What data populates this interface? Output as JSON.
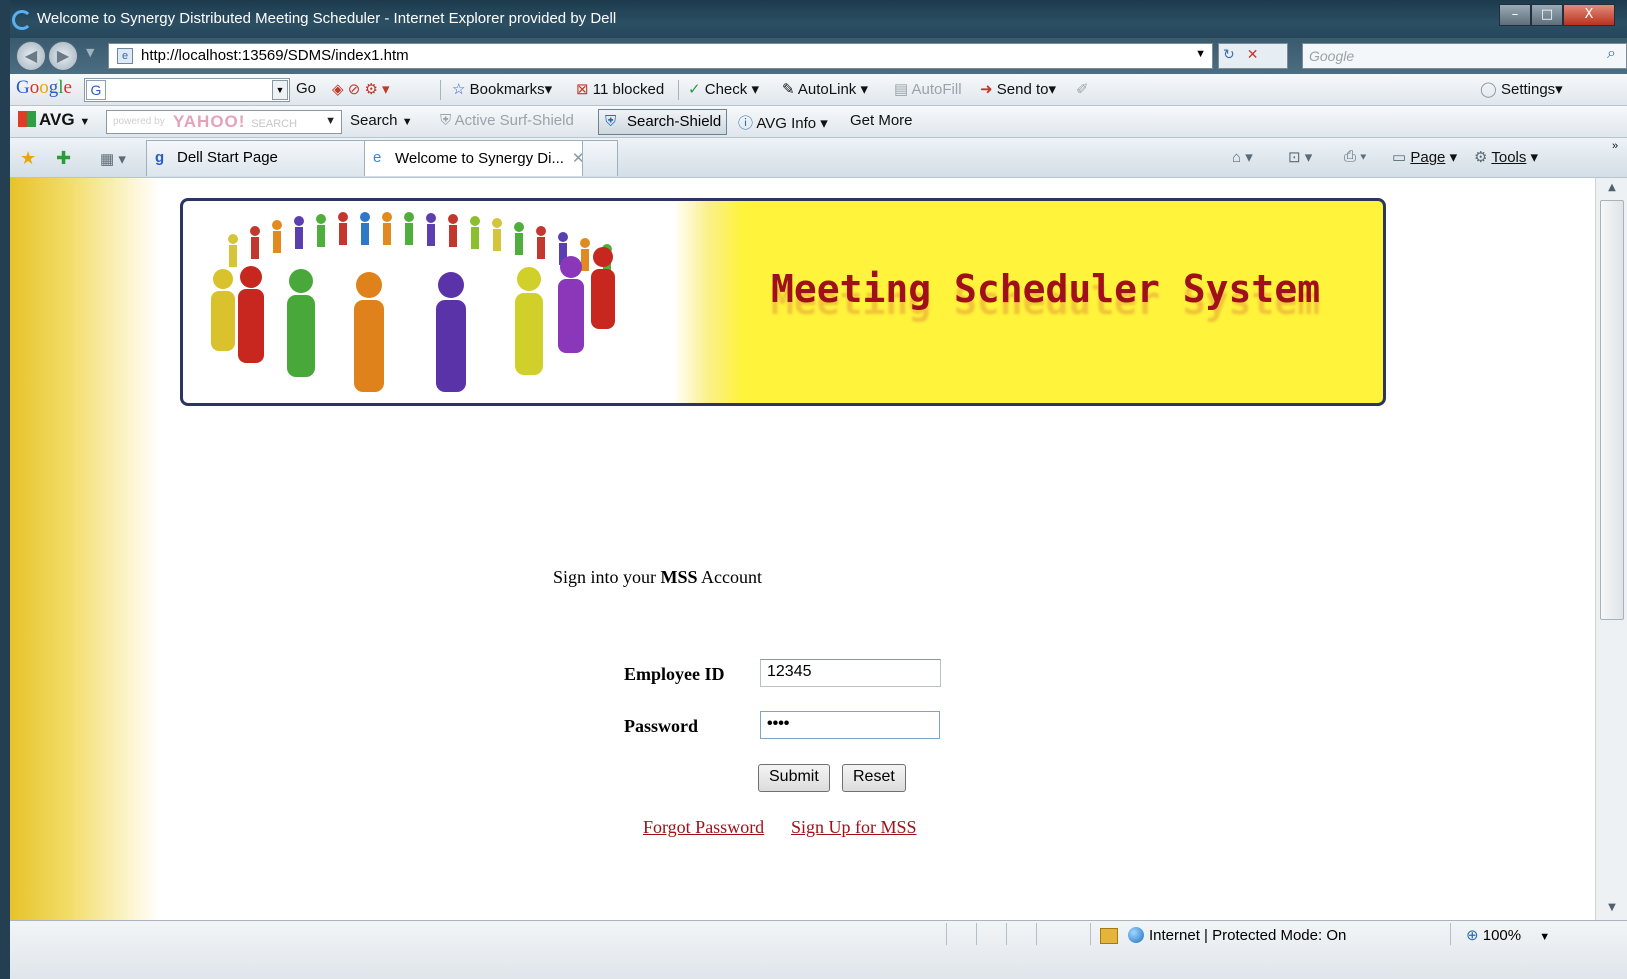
{
  "window": {
    "title": "Welcome to Synergy Distributed Meeting Scheduler - Internet Explorer provided by Dell",
    "min": "–",
    "max": "□",
    "close": "X"
  },
  "address": {
    "url": "http://localhost:13569/SDMS/index1.htm",
    "search_placeholder": "Google"
  },
  "google_toolbar": {
    "go": "Go",
    "bookmarks": "Bookmarks",
    "blocked": "11 blocked",
    "check": "Check",
    "autolink": "AutoLink",
    "autofill": "AutoFill",
    "sendto": "Send to",
    "settings": "Settings"
  },
  "avg_toolbar": {
    "brand": "AVG",
    "yahoo": "YAHOO!",
    "yahoo_sub": "SEARCH",
    "powered": "powered by",
    "search": "Search",
    "active_surf_shield": "Active Surf-Shield",
    "search_shield": "Search-Shield",
    "avg_info": "AVG Info",
    "get_more": "Get More"
  },
  "tabs": [
    {
      "label": "Dell Start Page"
    },
    {
      "label": "Welcome to Synergy Di..."
    }
  ],
  "command_bar": {
    "page": "Page",
    "tools": "Tools"
  },
  "banner": {
    "title": "Meeting Scheduler System"
  },
  "login": {
    "heading_pre": "Sign into your",
    "heading_bold": "MSS",
    "heading_post": "Account",
    "employee_id_label": "Employee ID",
    "employee_id_value": "12345",
    "password_label": "Password",
    "password_value": "••••",
    "submit": "Submit",
    "reset": "Reset",
    "forgot": "Forgot Password",
    "signup": "Sign Up for MSS"
  },
  "status": {
    "zone": "Internet | Protected Mode: On",
    "zoom": "100%"
  },
  "colors": {
    "accent": "#a0101a",
    "banner_yellow": "#fff33b",
    "sidebar_gold": "#e6c32a"
  }
}
